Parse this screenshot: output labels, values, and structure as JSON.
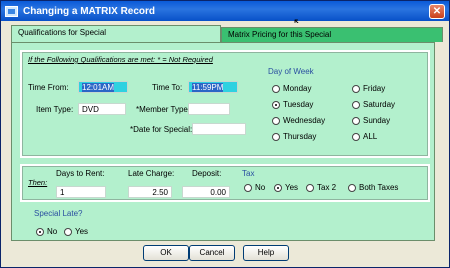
{
  "window": {
    "title": "Changing a MATRIX Record"
  },
  "tabs": [
    {
      "label": "Qualifications for Special"
    },
    {
      "label": "Matrix Pricing for this Special"
    }
  ],
  "qualifications": {
    "note": "If the Following Qualifications are met: * = Not Required",
    "time_from_label": "Time From:",
    "time_from_value": "12:01AM",
    "time_to_label": "Time To:",
    "time_to_value": "11:59PM",
    "item_type_label": "Item Type:",
    "item_type_value": "DVD",
    "member_type_label": "*Member Type:",
    "member_type_value": "",
    "date_label": "*Date for Special:",
    "date_value": ""
  },
  "day_of_week": {
    "label": "Day of Week",
    "options": [
      "Monday",
      "Tuesday",
      "Wednesday",
      "Thursday",
      "Friday",
      "Saturday",
      "Sunday",
      "ALL"
    ],
    "selected": "Tuesday"
  },
  "then": {
    "label": "Then:",
    "days_label": "Days to Rent:",
    "days_value": "1",
    "late_label": "Late Charge:",
    "late_value": "2.50",
    "deposit_label": "Deposit:",
    "deposit_value": "0.00"
  },
  "tax": {
    "label": "Tax",
    "options": [
      "No",
      "Yes",
      "Tax 2",
      "Both Taxes"
    ],
    "selected": "Yes"
  },
  "special_late": {
    "label": "Special Late?",
    "options": [
      "No",
      "Yes"
    ],
    "selected": "No"
  },
  "buttons": {
    "ok": "OK",
    "cancel": "Cancel",
    "help": "Help"
  }
}
